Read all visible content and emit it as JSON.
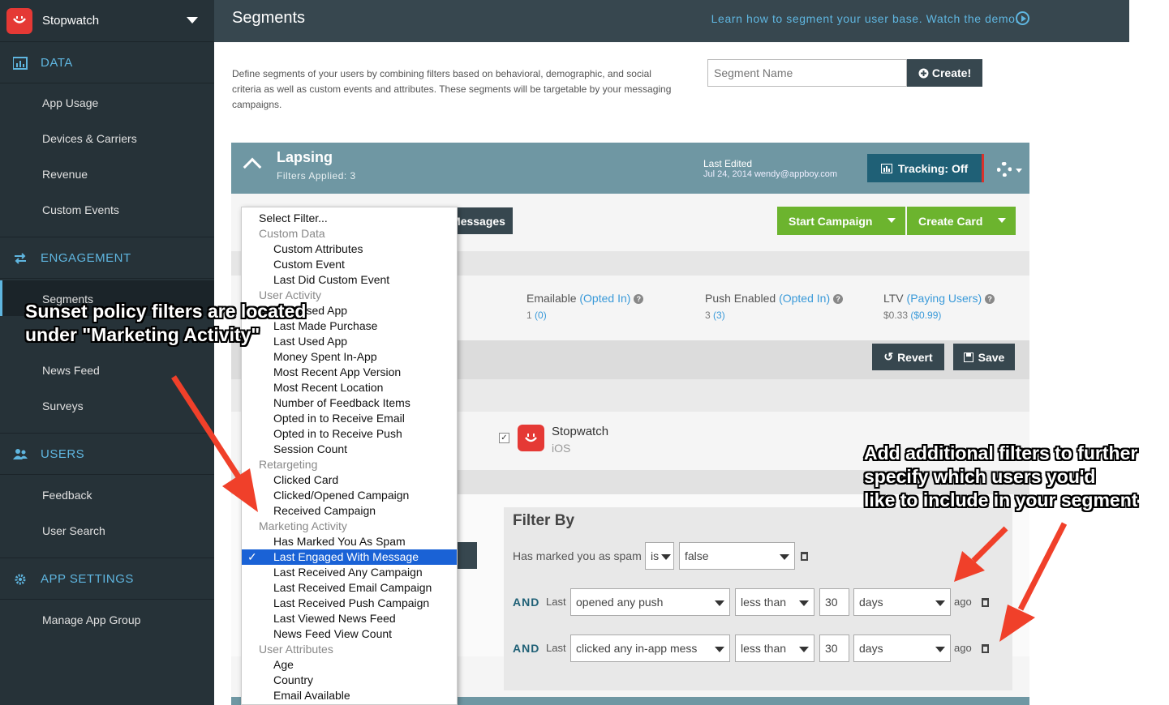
{
  "app": {
    "name": "Stopwatch"
  },
  "sidebar": {
    "sections": [
      {
        "label": "DATA",
        "icon": "bar-chart-icon",
        "items": [
          "App Usage",
          "Devices & Carriers",
          "Revenue",
          "Custom Events"
        ]
      },
      {
        "label": "ENGAGEMENT",
        "icon": "arrows-icon",
        "items": [
          "Segments",
          "",
          "News Feed",
          "Surveys"
        ]
      },
      {
        "label": "USERS",
        "icon": "users-icon",
        "items": [
          "Feedback",
          "User Search"
        ]
      },
      {
        "label": "APP SETTINGS",
        "icon": "gear-icon",
        "items": [
          "Manage App Group"
        ]
      }
    ],
    "active_item": "Segments"
  },
  "topbar": {
    "title": "Segments",
    "learn_link": "Learn how to segment your user base. Watch the demo."
  },
  "intro": {
    "description": "Define segments of your users by combining filters based on behavioral, demographic, and social criteria as well as custom events and attributes. These segments will be targetable by your messaging campaigns.",
    "segment_name_placeholder": "Segment Name",
    "create_label": "Create!"
  },
  "segment": {
    "name": "Lapsing",
    "filters_applied": "Filters Applied: 3",
    "last_edited_label": "Last Edited",
    "last_edited_value": "Jul 24, 2014 wendy@appboy.com",
    "tracking_label": "Tracking: Off",
    "messages_label": "Messages",
    "start_campaign_label": "Start Campaign",
    "create_card_label": "Create Card",
    "revert_label": "Revert",
    "save_label": "Save"
  },
  "stats": [
    {
      "label": "Emailable",
      "qualifier": "(Opted In)",
      "value": "1",
      "sub": "(0)"
    },
    {
      "label": "Push Enabled",
      "qualifier": "(Opted In)",
      "value": "3",
      "sub": "(3)"
    },
    {
      "label": "LTV",
      "qualifier": "(Paying Users)",
      "value": "$0.33",
      "sub": "($0.99)"
    }
  ],
  "app_row": {
    "name": "Stopwatch",
    "platform": "iOS"
  },
  "filter_by": {
    "title": "Filter By",
    "row1": {
      "label": "Has marked you as spam",
      "op": "is",
      "value": "false"
    },
    "row2": {
      "and": "AND",
      "last": "Last",
      "action": "opened any push",
      "cmp": "less than",
      "num": "30",
      "unit": "days",
      "ago": "ago"
    },
    "row3": {
      "and": "AND",
      "last": "Last",
      "action": "clicked any in-app mess",
      "cmp": "less than",
      "num": "30",
      "unit": "days",
      "ago": "ago"
    }
  },
  "dropdown": {
    "items": [
      {
        "type": "first",
        "text": "Select Filter..."
      },
      {
        "type": "group",
        "text": "Custom Data"
      },
      {
        "type": "opt",
        "text": "Custom Attributes"
      },
      {
        "type": "opt",
        "text": "Custom Event"
      },
      {
        "type": "opt",
        "text": "Last Did Custom Event"
      },
      {
        "type": "group",
        "text": "User Activity"
      },
      {
        "type": "opt",
        "text": "Last Used App"
      },
      {
        "type": "opt",
        "text": "Last Made Purchase"
      },
      {
        "type": "opt",
        "text": "Last Used App"
      },
      {
        "type": "opt",
        "text": "Money Spent In-App"
      },
      {
        "type": "opt",
        "text": "Most Recent App Version"
      },
      {
        "type": "opt",
        "text": "Most Recent Location"
      },
      {
        "type": "opt",
        "text": "Number of Feedback Items"
      },
      {
        "type": "opt",
        "text": "Opted in to Receive Email"
      },
      {
        "type": "opt",
        "text": "Opted in to Receive Push"
      },
      {
        "type": "opt",
        "text": "Session Count"
      },
      {
        "type": "group",
        "text": "Retargeting"
      },
      {
        "type": "opt",
        "text": "Clicked Card"
      },
      {
        "type": "opt",
        "text": "Clicked/Opened Campaign"
      },
      {
        "type": "opt",
        "text": "Received Campaign"
      },
      {
        "type": "group",
        "text": "Marketing Activity"
      },
      {
        "type": "opt",
        "text": "Has Marked You As Spam"
      },
      {
        "type": "selected",
        "text": "Last Engaged With Message"
      },
      {
        "type": "opt",
        "text": "Last Received Any Campaign"
      },
      {
        "type": "opt",
        "text": "Last Received Email Campaign"
      },
      {
        "type": "opt",
        "text": "Last Received Push Campaign"
      },
      {
        "type": "opt",
        "text": "Last Viewed News Feed"
      },
      {
        "type": "opt",
        "text": "News Feed View Count"
      },
      {
        "type": "group",
        "text": "User Attributes"
      },
      {
        "type": "opt",
        "text": "Age"
      },
      {
        "type": "opt",
        "text": "Country"
      },
      {
        "type": "opt",
        "text": "Email Available"
      }
    ]
  },
  "annotations": {
    "left_line1": "Sunset policy filters are located",
    "left_line2": "under \"Marketing Activity\"",
    "right_line1": "Add additional filters to further",
    "right_line2": "specify which users you'd",
    "right_line3": "like to include in your segment"
  },
  "colors": {
    "sidebar": "#263238",
    "accent": "#5fb6e0",
    "header": "#6f97a3",
    "green": "#6cb42e",
    "arrow": "#f0402a"
  }
}
